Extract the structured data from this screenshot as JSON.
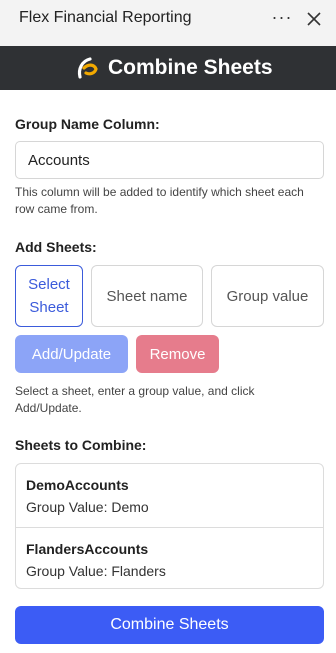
{
  "titlebar": {
    "title": "Flex Financial Reporting",
    "more_label": "···"
  },
  "header": {
    "title": "Combine Sheets",
    "background": "#2f3134",
    "logo_colors": [
      "#ffffff",
      "#f2a900"
    ]
  },
  "group_name": {
    "label": "Group Name Column:",
    "value": "Accounts",
    "help": "This column will be added to identify which sheet each row came from."
  },
  "add_sheets": {
    "label": "Add Sheets:",
    "select_button": "Select Sheet",
    "sheet_name_placeholder": "Sheet name",
    "group_value_placeholder": "Group value",
    "add_button": "Add/Update",
    "remove_button": "Remove",
    "help": "Select a sheet, enter a group value, and click Add/Update."
  },
  "sheets_to_combine": {
    "label": "Sheets to Combine:",
    "items": [
      {
        "name": "DemoAccounts",
        "group_value": "Group Value: Demo"
      },
      {
        "name": "FlandersAccounts",
        "group_value": "Group Value: Flanders"
      }
    ]
  },
  "combine_button": "Combine Sheets",
  "colors": {
    "primary": "#3c5cf5",
    "primary_light": "#8ca4f7",
    "danger_light": "#e67c8c",
    "select_outline": "#3b5bdb"
  }
}
